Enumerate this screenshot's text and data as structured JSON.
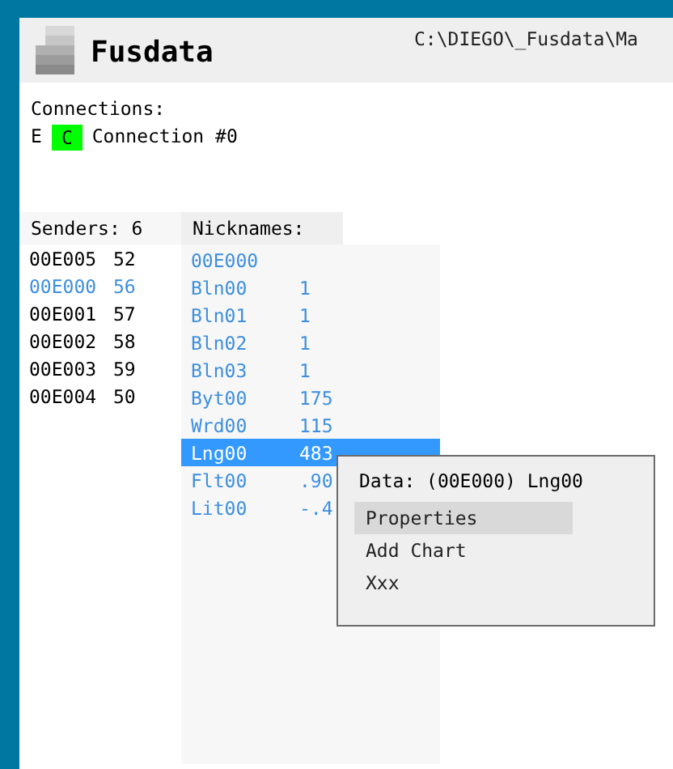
{
  "app": {
    "title": "Fusdata",
    "path": "C:\\DIEGO\\_Fusdata\\Ma"
  },
  "connections": {
    "label": "Connections:",
    "items": [
      {
        "prefix": "E",
        "status": "C",
        "color": "#00ff00",
        "name": "Connection #0"
      }
    ]
  },
  "senders": {
    "heading": "Senders: 6",
    "rows": [
      {
        "id": "00E005",
        "value": "52",
        "selected": false
      },
      {
        "id": "00E000",
        "value": "56",
        "selected": true
      },
      {
        "id": "00E001",
        "value": "57",
        "selected": false
      },
      {
        "id": "00E002",
        "value": "58",
        "selected": false
      },
      {
        "id": "00E003",
        "value": "59",
        "selected": false
      },
      {
        "id": "00E004",
        "value": "50",
        "selected": false
      }
    ]
  },
  "nicknames": {
    "heading": "Nicknames:",
    "owner": "00E000",
    "rows": [
      {
        "name": "Bln00",
        "value": "1",
        "selected": false
      },
      {
        "name": "Bln01",
        "value": "1",
        "selected": false
      },
      {
        "name": "Bln02",
        "value": "1",
        "selected": false
      },
      {
        "name": "Bln03",
        "value": "1",
        "selected": false
      },
      {
        "name": "Byt00",
        "value": "175",
        "selected": false
      },
      {
        "name": "Wrd00",
        "value": "115",
        "selected": false
      },
      {
        "name": "Lng00",
        "value": "483",
        "selected": true
      },
      {
        "name": "Flt00",
        "value": ".90",
        "selected": false
      },
      {
        "name": "Lit00",
        "value": "-.4",
        "selected": false
      }
    ]
  },
  "context_menu": {
    "title": "Data: (00E000) Lng00",
    "items": [
      {
        "label": "Properties",
        "selected": true
      },
      {
        "label": "Add Chart",
        "selected": false
      },
      {
        "label": "Xxx",
        "selected": false
      }
    ]
  }
}
